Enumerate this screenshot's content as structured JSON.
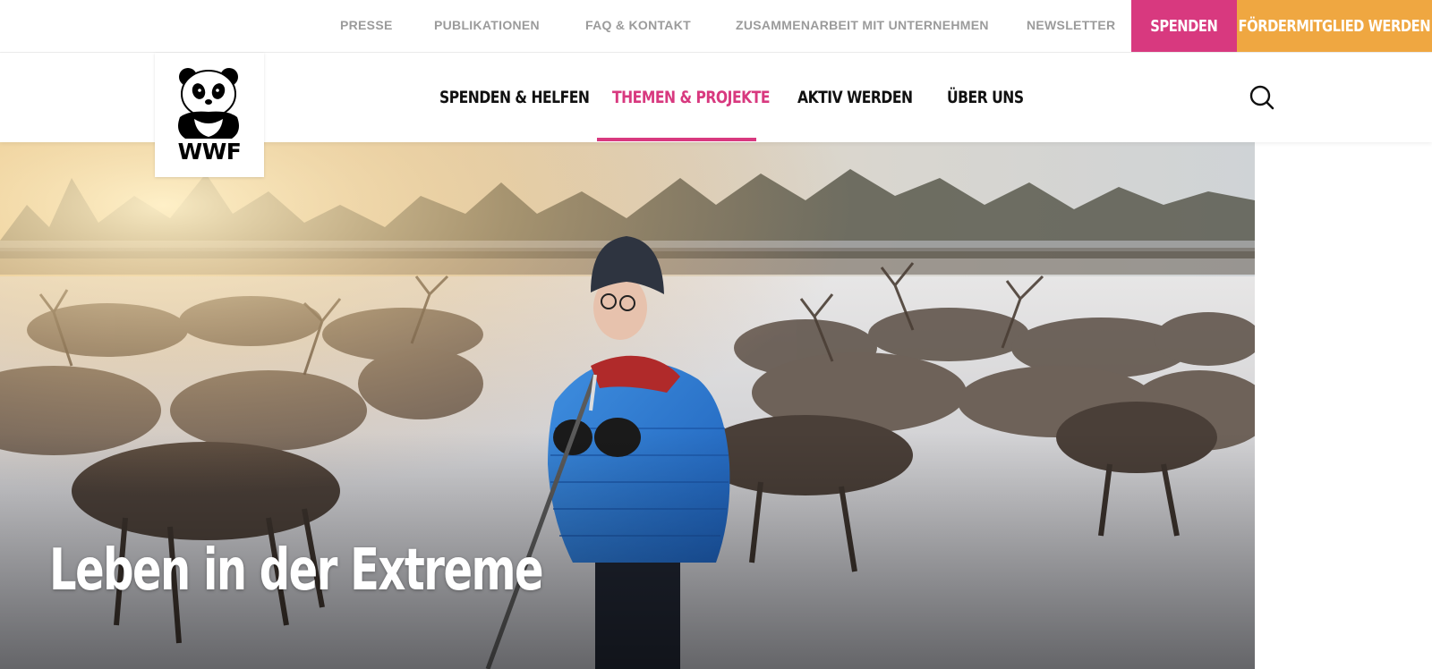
{
  "topbar": {
    "links": [
      "PRESSE",
      "PUBLIKATIONEN",
      "FAQ & KONTAKT",
      "ZUSAMMENARBEIT MIT UNTERNEHMEN",
      "NEWSLETTER"
    ],
    "donate_label": "SPENDEN",
    "member_label": "FÖRDERMITGLIED WERDEN"
  },
  "nav": {
    "items": [
      {
        "label": "SPENDEN & HELFEN",
        "active": false
      },
      {
        "label": "THEMEN & PROJEKTE",
        "active": true
      },
      {
        "label": "AKTIV WERDEN",
        "active": false
      },
      {
        "label": "ÜBER UNS",
        "active": false
      }
    ],
    "search_icon": "search-icon"
  },
  "logo": {
    "text": "WWF",
    "icon": "panda-logo"
  },
  "hero": {
    "title": "Leben in der Extreme"
  },
  "colors": {
    "accent_pink": "#d8397f",
    "accent_orange": "#efa741",
    "nav_text": "#111111",
    "toplink_text": "#9b9b9b"
  }
}
